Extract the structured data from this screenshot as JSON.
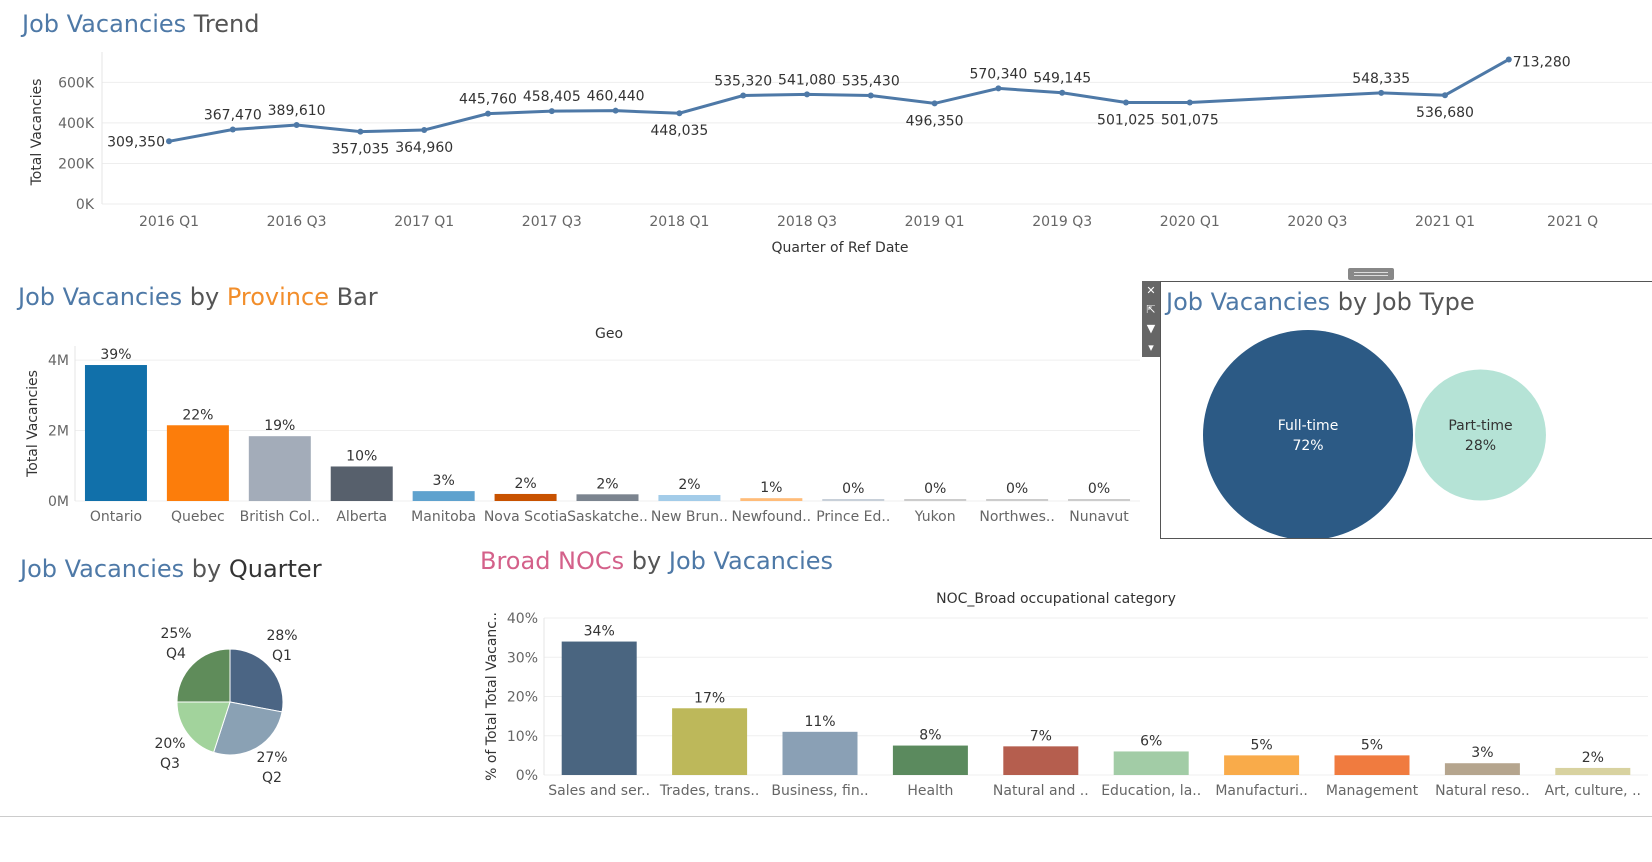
{
  "titles": {
    "trend": {
      "a": "Job Vacancies",
      "b": " Trend"
    },
    "province": {
      "a": "Job Vacancies",
      "b": " by ",
      "c": "Province",
      "d": " Bar"
    },
    "jobtype": {
      "a": "Job Vacancies",
      "b": " by ",
      "c": "Job Type"
    },
    "quarter": {
      "a": "Job Vacancies",
      "b": " by ",
      "c": "Quarter"
    },
    "noc": {
      "a": "Broad NOCs",
      "b": " by ",
      "c": "Job Vacancies"
    }
  },
  "toolbar": {
    "close_icon": "✕",
    "popout_icon": "⇱",
    "filter_icon": "▼",
    "more_icon": "▾"
  },
  "chart_data": [
    {
      "id": "trend",
      "type": "line",
      "xlabel": "Quarter of Ref Date",
      "ylabel": "Total Vacancies",
      "ylim": [
        0,
        750000
      ],
      "yticks": [
        {
          "v": 0,
          "label": "0K"
        },
        {
          "v": 200000,
          "label": "200K"
        },
        {
          "v": 400000,
          "label": "400K"
        },
        {
          "v": 600000,
          "label": "600K"
        }
      ],
      "xticks": [
        "2016 Q1",
        "2016 Q3",
        "2017 Q1",
        "2017 Q3",
        "2018 Q1",
        "2018 Q3",
        "2019 Q1",
        "2019 Q3",
        "2020 Q1",
        "2020 Q3",
        "2021 Q1",
        "2021 Q"
      ],
      "points": [
        {
          "x": "2016 Q1",
          "y": 309350,
          "label": "309,350"
        },
        {
          "x": "2016 Q2",
          "y": 367470,
          "label": "367,470"
        },
        {
          "x": "2016 Q3",
          "y": 389610,
          "label": "389,610"
        },
        {
          "x": "2016 Q4",
          "y": 357035,
          "label": "357,035"
        },
        {
          "x": "2017 Q1",
          "y": 364960,
          "label": "364,960"
        },
        {
          "x": "2017 Q2",
          "y": 445760,
          "label": "445,760"
        },
        {
          "x": "2017 Q3",
          "y": 458405,
          "label": "458,405"
        },
        {
          "x": "2017 Q4",
          "y": 460440,
          "label": "460,440"
        },
        {
          "x": "2018 Q1",
          "y": 448035,
          "label": "448,035"
        },
        {
          "x": "2018 Q2",
          "y": 535320,
          "label": "535,320"
        },
        {
          "x": "2018 Q3",
          "y": 541080,
          "label": "541,080"
        },
        {
          "x": "2018 Q4",
          "y": 535430,
          "label": "535,430"
        },
        {
          "x": "2019 Q1",
          "y": 496350,
          "label": "496,350"
        },
        {
          "x": "2019 Q2",
          "y": 570340,
          "label": "570,340"
        },
        {
          "x": "2019 Q3",
          "y": 549145,
          "label": "549,145"
        },
        {
          "x": "2019 Q4",
          "y": 501025,
          "label": "501,025"
        },
        {
          "x": "2020 Q1",
          "y": 501075,
          "label": "501,075"
        },
        {
          "x": "2020 Q4",
          "y": 548335,
          "label": "548,335"
        },
        {
          "x": "2021 Q1",
          "y": 536680,
          "label": "536,680"
        },
        {
          "x": "2021 Q2",
          "y": 713280,
          "label": "713,280"
        }
      ]
    },
    {
      "id": "province",
      "type": "bar",
      "header": "Geo",
      "ylabel": "Total Vacancies",
      "ylim": [
        0,
        4400000
      ],
      "yticks": [
        {
          "v": 0,
          "label": "0M"
        },
        {
          "v": 2000000,
          "label": "2M"
        },
        {
          "v": 4000000,
          "label": "4M"
        }
      ],
      "categories": [
        "Ontario",
        "Quebec",
        "British Col..",
        "Alberta",
        "Manitoba",
        "Nova Scotia",
        "Saskatche..",
        "New Brun..",
        "Newfound..",
        "Prince Ed..",
        "Yukon",
        "Northwes..",
        "Nunavut"
      ],
      "values": [
        3860000,
        2150000,
        1840000,
        980000,
        280000,
        200000,
        190000,
        170000,
        80000,
        30000,
        6000,
        5000,
        3000
      ],
      "labels": [
        "39%",
        "22%",
        "19%",
        "10%",
        "3%",
        "2%",
        "2%",
        "2%",
        "1%",
        "0%",
        "0%",
        "0%",
        "0%"
      ],
      "colors": [
        "#1170aa",
        "#fc7d0b",
        "#a3acb9",
        "#57606c",
        "#5fa2ce",
        "#c85200",
        "#7b848f",
        "#a3cce9",
        "#ffbc79",
        "#c8d0d9",
        "#cccccc",
        "#cccccc",
        "#cccccc"
      ]
    },
    {
      "id": "jobtype",
      "type": "bubble",
      "items": [
        {
          "name": "Full-time",
          "label": "72%",
          "value": 72,
          "color": "#2c5a85",
          "text_color": "#ffffff"
        },
        {
          "name": "Part-time",
          "label": "28%",
          "value": 28,
          "color": "#b5e3d6",
          "text_color": "#333333"
        }
      ]
    },
    {
      "id": "quarter",
      "type": "pie",
      "slices": [
        {
          "name": "Q1",
          "pct": "28%",
          "value": 28,
          "color": "#4b6584"
        },
        {
          "name": "Q2",
          "pct": "27%",
          "value": 27,
          "color": "#8aa1b4"
        },
        {
          "name": "Q3",
          "pct": "20%",
          "value": 20,
          "color": "#a2d39c"
        },
        {
          "name": "Q4",
          "pct": "25%",
          "value": 25,
          "color": "#5f8c5a"
        }
      ]
    },
    {
      "id": "noc",
      "type": "bar",
      "header": "NOC_Broad occupational category",
      "ylabel": "% of Total Total Vacanc..",
      "ylim": [
        0,
        0.4
      ],
      "yticks": [
        {
          "v": 0,
          "label": "0%"
        },
        {
          "v": 0.1,
          "label": "10%"
        },
        {
          "v": 0.2,
          "label": "20%"
        },
        {
          "v": 0.3,
          "label": "30%"
        },
        {
          "v": 0.4,
          "label": "40%"
        }
      ],
      "categories": [
        "Sales and ser..",
        "Trades, trans..",
        "Business, fin..",
        "Health",
        "Natural and ..",
        "Education, la..",
        "Manufacturi..",
        "Management",
        "Natural reso..",
        "Art, culture, .."
      ],
      "values": [
        0.34,
        0.17,
        0.11,
        0.075,
        0.073,
        0.06,
        0.05,
        0.05,
        0.03,
        0.018
      ],
      "labels": [
        "34%",
        "17%",
        "11%",
        "8%",
        "7%",
        "6%",
        "5%",
        "5%",
        "3%",
        "2%"
      ],
      "colors": [
        "#4a6580",
        "#bdb85a",
        "#8aa0b5",
        "#5b8a5e",
        "#b55e4e",
        "#a2cca6",
        "#f9ab4a",
        "#f07b3f",
        "#b5a58e",
        "#d8d2a0"
      ]
    }
  ]
}
